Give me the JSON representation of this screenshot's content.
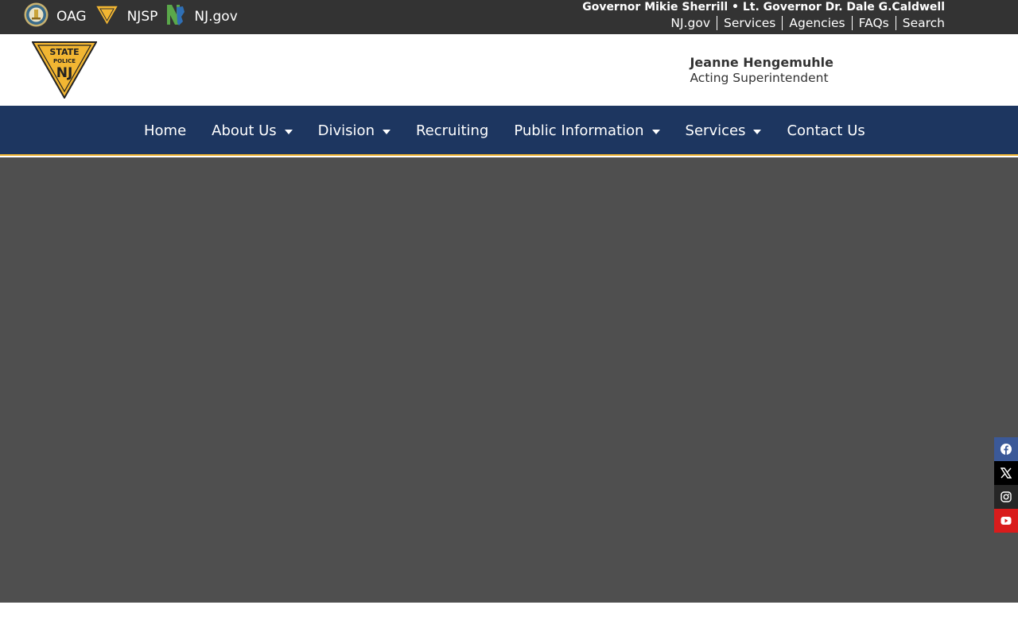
{
  "topbar": {
    "links": [
      {
        "label": "OAG",
        "icon": "oag-seal-icon"
      },
      {
        "label": "NJSP",
        "icon": "njsp-badge-icon"
      },
      {
        "label": "NJ.gov",
        "icon": "nj-state-icon"
      }
    ],
    "governor_line": "Governor Mikie Sherrill • Lt. Governor Dr. Dale G.Caldwell",
    "utility_nav": [
      "NJ.gov",
      "Services",
      "Agencies",
      "FAQs",
      "Search"
    ]
  },
  "header": {
    "logo_text": "STATE POLICE NJ",
    "superintendent_name": "Jeanne Hengemuhle",
    "superintendent_title": "Acting Superintendent"
  },
  "nav": {
    "items": [
      {
        "label": "Home",
        "dropdown": false
      },
      {
        "label": "About Us",
        "dropdown": true
      },
      {
        "label": "Division",
        "dropdown": true
      },
      {
        "label": "Recruiting",
        "dropdown": false
      },
      {
        "label": "Public Information",
        "dropdown": true
      },
      {
        "label": "Services",
        "dropdown": true
      },
      {
        "label": "Contact Us",
        "dropdown": false
      }
    ]
  },
  "social": [
    "facebook-icon",
    "x-icon",
    "instagram-icon",
    "youtube-icon"
  ],
  "colors": {
    "topbar": "#333333",
    "nav": "#1d3660",
    "accent": "#f2b632",
    "hero": "#4f4f4f"
  }
}
